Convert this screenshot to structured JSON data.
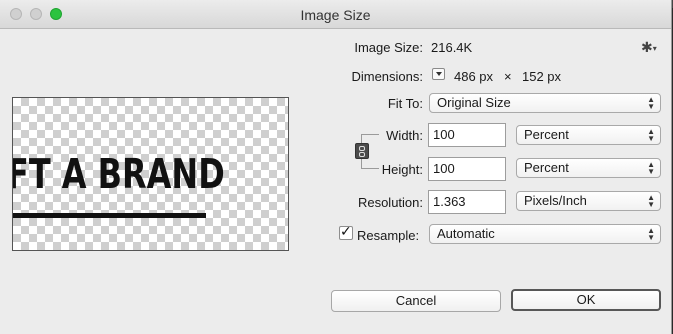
{
  "window": {
    "title": "Image Size"
  },
  "preview": {
    "text": "FT A BRAND"
  },
  "image_size": {
    "label": "Image Size:",
    "value": "216.4K"
  },
  "settings": {
    "icon": "gear-icon"
  },
  "dimensions": {
    "label": "Dimensions:",
    "width": "486 px",
    "times": "×",
    "height": "152 px"
  },
  "fit_to": {
    "label": "Fit To:",
    "selected": "Original Size"
  },
  "width": {
    "label": "Width:",
    "value": "100",
    "unit": "Percent"
  },
  "height": {
    "label": "Height:",
    "value": "100",
    "unit": "Percent"
  },
  "resolution": {
    "label": "Resolution:",
    "value": "1.363",
    "unit": "Pixels/Inch"
  },
  "resample": {
    "label": "Resample:",
    "checked": true,
    "selected": "Automatic"
  },
  "buttons": {
    "cancel": "Cancel",
    "ok": "OK"
  },
  "colors": {
    "zoom_button": "#2bc33f",
    "window_bg": "#ececec"
  }
}
